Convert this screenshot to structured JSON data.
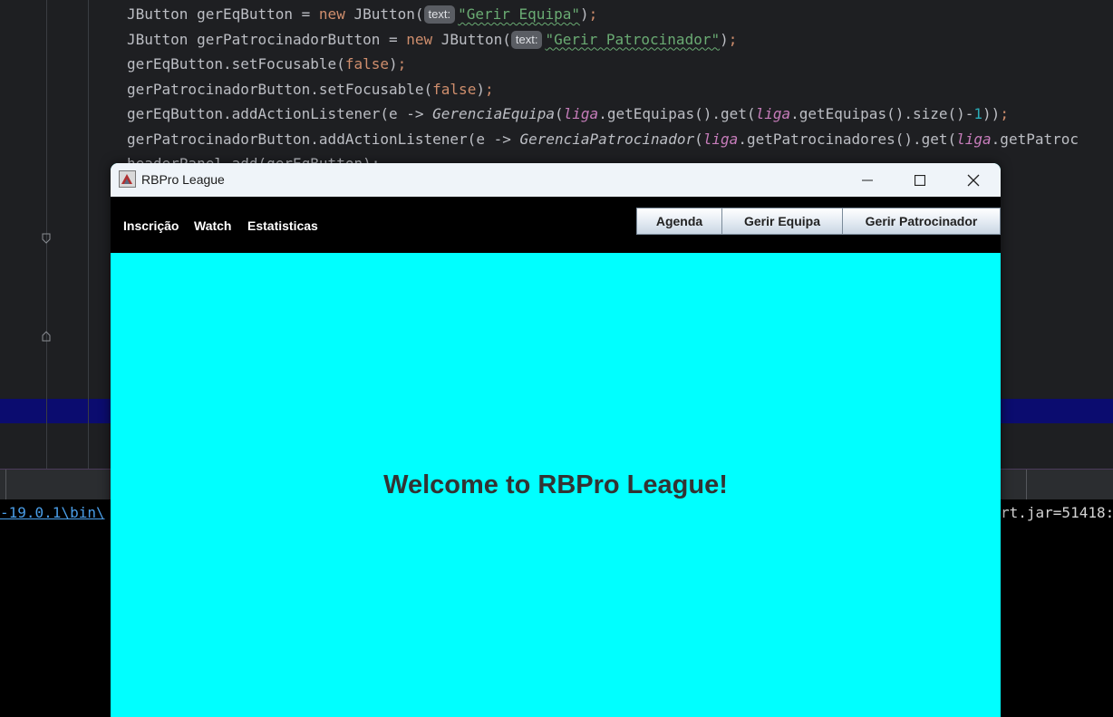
{
  "ide": {
    "code_lines": [
      {
        "parts": [
          [
            "t",
            "JButton gerEqButton = "
          ],
          [
            "kw",
            "new"
          ],
          [
            "t",
            " JButton("
          ],
          [
            "hint",
            "text:"
          ],
          [
            "str",
            "\"Gerir Equipa\""
          ],
          [
            "t",
            ")"
          ],
          [
            "kw",
            ";"
          ]
        ]
      },
      {
        "parts": [
          [
            "t",
            "JButton gerPatrocinadorButton = "
          ],
          [
            "kw",
            "new"
          ],
          [
            "t",
            " JButton("
          ],
          [
            "hint",
            "text:"
          ],
          [
            "str",
            "\"Gerir Patrocinador\""
          ],
          [
            "t",
            ")"
          ],
          [
            "kw",
            ";"
          ]
        ]
      },
      {
        "parts": [
          [
            "t",
            "gerEqButton.setFocusable("
          ],
          [
            "kw",
            "false"
          ],
          [
            "t",
            ")"
          ],
          [
            "kw",
            ";"
          ]
        ]
      },
      {
        "parts": [
          [
            "t",
            "gerPatrocinadorButton.setFocusable("
          ],
          [
            "kw",
            "false"
          ],
          [
            "t",
            ")"
          ],
          [
            "kw",
            ";"
          ]
        ]
      },
      {
        "parts": [
          [
            "t",
            "gerEqButton.addActionListener(e -> "
          ],
          [
            "it",
            "GerenciaEquipa"
          ],
          [
            "t",
            "("
          ],
          [
            "fld",
            "liga"
          ],
          [
            "t",
            ".getEquipas().get("
          ],
          [
            "fld",
            "liga"
          ],
          [
            "t",
            ".getEquipas().size()-"
          ],
          [
            "num",
            "1"
          ],
          [
            "t",
            "))"
          ],
          [
            "kw",
            ";"
          ]
        ]
      },
      {
        "parts": [
          [
            "t",
            "gerPatrocinadorButton.addActionListener(e -> "
          ],
          [
            "it",
            "GerenciaPatrocinador"
          ],
          [
            "t",
            "("
          ],
          [
            "fld",
            "liga"
          ],
          [
            "t",
            ".getPatrocinadores().get("
          ],
          [
            "fld",
            "liga"
          ],
          [
            "t",
            ".getPatroc"
          ]
        ]
      }
    ],
    "cut_line": "headerPanel.add(gerEqButton);",
    "console_path": "-19.0.1\\bin\\",
    "console_right": "rt.jar=51418:"
  },
  "window": {
    "title": "RBPro League",
    "controls": {
      "minimize": "minimize-icon",
      "maximize": "maximize-icon",
      "close": "close-icon"
    },
    "nav": [
      "Inscrição",
      "Watch",
      "Estatisticas"
    ],
    "buttons": [
      "Agenda",
      "Gerir Equipa",
      "Gerir Patrocinador"
    ],
    "welcome": "Welcome to RBPro League!",
    "colors": {
      "content_bg": "#00ffff",
      "header_bg": "#000000",
      "welcome_text": "#333333"
    }
  }
}
